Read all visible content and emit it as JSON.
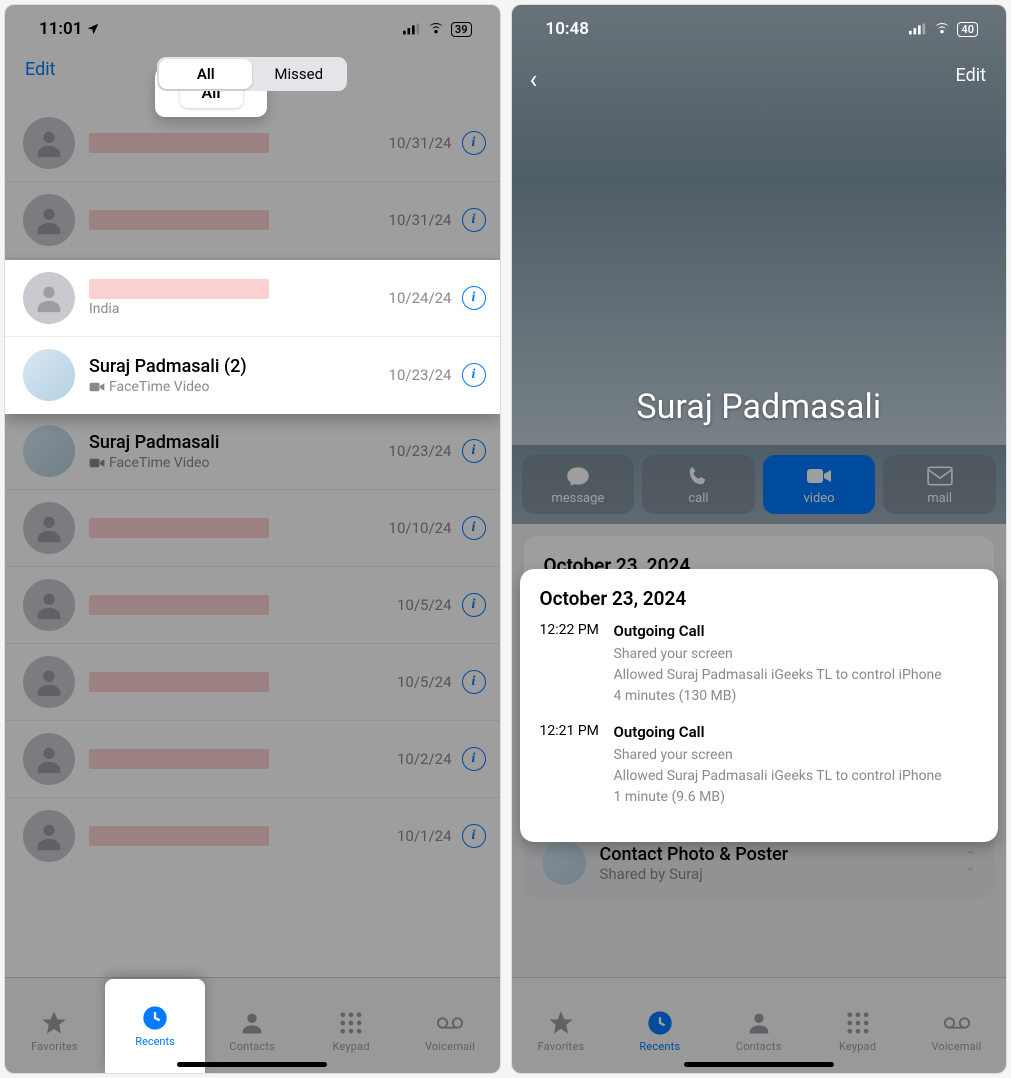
{
  "left": {
    "status": {
      "time": "11:01",
      "battery": "39"
    },
    "edit_label": "Edit",
    "tabs": {
      "all": "All",
      "missed": "Missed"
    },
    "calls": [
      {
        "name": "",
        "redact": true,
        "sub": "",
        "date": "10/31/24"
      },
      {
        "name": "",
        "redact": true,
        "sub": "",
        "date": "10/31/24"
      },
      {
        "name": "",
        "redact": true,
        "sub": "India",
        "date": "10/24/24"
      },
      {
        "name": "Suraj Padmasali (2)",
        "sub": "FaceTime Video",
        "facetime": true,
        "date": "10/23/24"
      },
      {
        "name": "Suraj Padmasali",
        "sub": "FaceTime Video",
        "facetime": true,
        "date": "10/23/24"
      },
      {
        "name": "",
        "redact": true,
        "sub": "",
        "date": "10/10/24"
      },
      {
        "name": "",
        "redact": true,
        "sub": "",
        "date": "10/5/24"
      },
      {
        "name": "",
        "redact": true,
        "sub": "",
        "date": "10/5/24"
      },
      {
        "name": "",
        "redact": true,
        "sub": "",
        "date": "10/2/24"
      },
      {
        "name": "",
        "redact": true,
        "sub": "",
        "date": "10/1/24"
      }
    ],
    "tabbar": {
      "favorites": "Favorites",
      "recents": "Recents",
      "contacts": "Contacts",
      "keypad": "Keypad",
      "voicemail": "Voicemail"
    }
  },
  "right": {
    "status": {
      "time": "10:48",
      "battery": "40"
    },
    "edit_label": "Edit",
    "contact_name": "Suraj Padmasali",
    "actions": {
      "message": "message",
      "call": "call",
      "video": "video",
      "mail": "mail"
    },
    "log_date": "October 23, 2024",
    "logs": [
      {
        "time": "12:22 PM",
        "title": "Outgoing Call",
        "l1": "Shared your screen",
        "l2": "Allowed Suraj Padmasali iGeeks TL to control iPhone",
        "l3": "4 minutes (130 MB)"
      },
      {
        "time": "12:21 PM",
        "title": "Outgoing Call",
        "l1": "Shared your screen",
        "l2": "Allowed Suraj Padmasali iGeeks TL to control iPhone",
        "l3": "1 minute (9.6 MB)"
      }
    ],
    "poster": {
      "title": "Contact Photo & Poster",
      "sub": "Shared by Suraj"
    },
    "tabbar": {
      "favorites": "Favorites",
      "recents": "Recents",
      "contacts": "Contacts",
      "keypad": "Keypad",
      "voicemail": "Voicemail"
    }
  }
}
